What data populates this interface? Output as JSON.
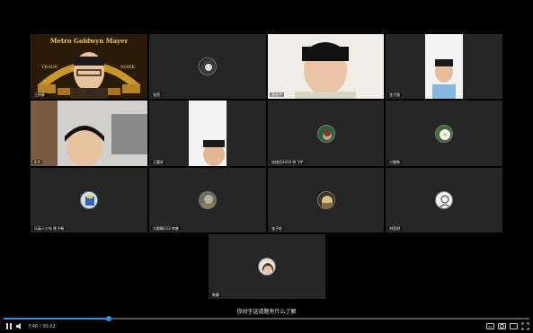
{
  "participants": [
    {
      "name": "王梓豪",
      "logo_lines": [
        "Metro Goldwyn Mayer",
        "TRADE",
        "MARK"
      ]
    },
    {
      "name": "张然"
    },
    {
      "name": "黄俊宇"
    },
    {
      "name": "张子宸"
    },
    {
      "name": "X X"
    },
    {
      "name": "王嘉轩"
    },
    {
      "name": "快递员2019 陈飞宇"
    },
    {
      "name": "小猫咪"
    },
    {
      "name": "乐高人少年 陈子畅"
    },
    {
      "name": "大眼睛123 李睿"
    },
    {
      "name": "张子轩"
    },
    {
      "name": "刘思玥"
    },
    {
      "name": "陈静"
    }
  ],
  "subtitle": "你对于这道题有什么了解",
  "player": {
    "time": "7:46 / 30:22",
    "progress": 0.2,
    "buttons": [
      "play-pause",
      "volume",
      "subtitles",
      "settings",
      "theater",
      "fullscreen"
    ]
  },
  "colors": {
    "tile_bg": "#262626",
    "accent": "#2f8fe6",
    "active_outline": "#8fd16f"
  }
}
